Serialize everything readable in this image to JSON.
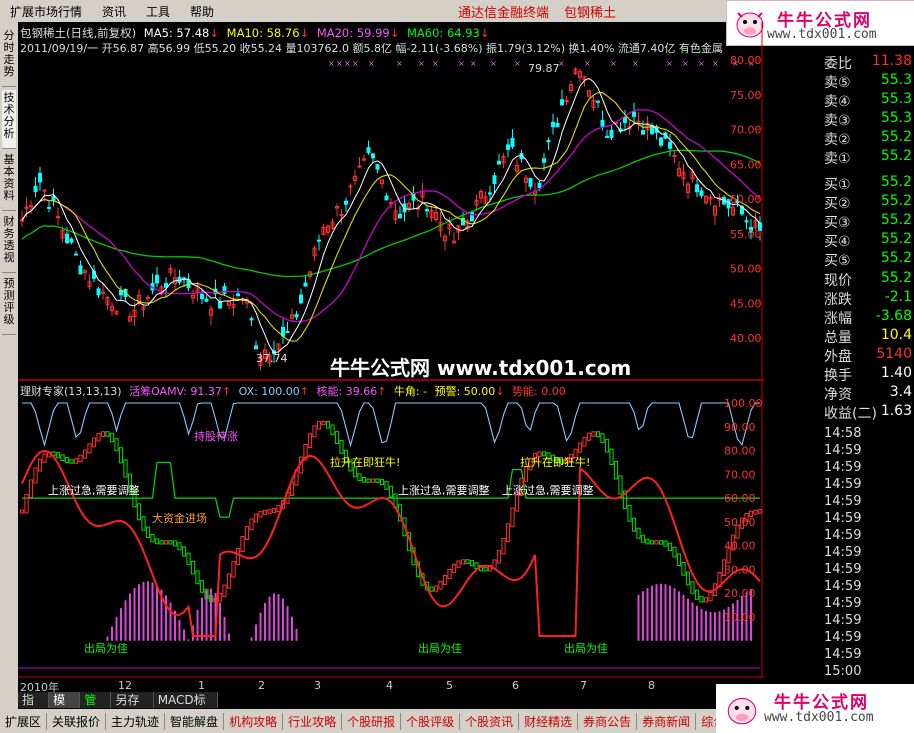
{
  "menu": {
    "items": [
      "扩展市场行情",
      "资讯",
      "工具",
      "帮助"
    ],
    "title": "通达信金融终端",
    "subtitle": "包钢稀土"
  },
  "logo": {
    "text": "牛牛公式网",
    "url": "www.tdx001.com"
  },
  "left_tabs": [
    "分时走势",
    "技术分析",
    "基本资料",
    "财务透视",
    "预测评级"
  ],
  "price_header": {
    "line1": {
      "name": "包钢稀土(日线,前复权)",
      "ma5": "MA5: 57.48",
      "ma10": "MA10: 58.76",
      "ma20": "MA20: 59.99",
      "ma60": "MA60: 64.93"
    },
    "line2": "2011/09/19/一 开56.87 高56.99 低55.20 收55.24 量103762.0 额5.8亿 幅-2.11(-3.68%) 振1.79(3.12%) 换1.40% 流通7.40亿 有色金属"
  },
  "price_axis": [
    "80.00",
    "75.00",
    "70.00",
    "65.00",
    "60.00",
    "55.00",
    "50.00",
    "45.00",
    "40.00"
  ],
  "price_marks": {
    "high": "79.87",
    "low": "37.74"
  },
  "indicator_header": {
    "name": "理财专家(13,13,13)",
    "a": "活筹OAMV: 91.37",
    "b": "OX: 100.00",
    "c": "核能: 39.66",
    "d": "牛角: -",
    "e": "预警: 50.00",
    "f": "势能: 0.00"
  },
  "indicator_axis": [
    "100.00",
    "90.00",
    "80.00",
    "70.00",
    "60.00",
    "50.00",
    "40.00",
    "30.00",
    "20.00",
    "10.00"
  ],
  "annotations": {
    "hold": "持股待涨",
    "rally1": "拉升在即狂牛!",
    "rally2": "拉升在即狂牛!",
    "adj1": "上涨过急,需要调整",
    "adj2": "上涨过急,需要调整",
    "adj3": "上涨过急,需要调整",
    "bigfund": "大资金进场",
    "exit1": "出局为佳",
    "exit2": "出局为佳",
    "exit3": "出局为佳"
  },
  "time_axis": [
    "2010年",
    "12",
    "1",
    "2",
    "3",
    "4",
    "5",
    "6",
    "7",
    "8"
  ],
  "watermark": "牛牛公式网 www.tdx001.com",
  "right_panel": {
    "weibi": {
      "label": "委比",
      "value": "11.38"
    },
    "asks": [
      {
        "label": "卖⑤",
        "value": "55.3"
      },
      {
        "label": "卖④",
        "value": "55.3"
      },
      {
        "label": "卖③",
        "value": "55.3"
      },
      {
        "label": "卖②",
        "value": "55.2"
      },
      {
        "label": "卖①",
        "value": "55.2"
      }
    ],
    "bids": [
      {
        "label": "买①",
        "value": "55.2"
      },
      {
        "label": "买②",
        "value": "55.2"
      },
      {
        "label": "买③",
        "value": "55.2"
      },
      {
        "label": "买④",
        "value": "55.2"
      },
      {
        "label": "买⑤",
        "value": "55.2"
      }
    ],
    "stats": [
      {
        "label": "现价",
        "value": "55.2"
      },
      {
        "label": "涨跌",
        "value": "-2.1"
      },
      {
        "label": "涨幅",
        "value": "-3.68"
      },
      {
        "label": "总量",
        "value": "10.4"
      },
      {
        "label": "外盘",
        "value": "5140"
      },
      {
        "label": "换手",
        "value": "1.40"
      },
      {
        "label": "净资",
        "value": "3.4"
      },
      {
        "label": "收益(二)",
        "value": "1.63"
      }
    ],
    "ticks": [
      "14:58",
      "14:59",
      "14:59",
      "14:59",
      "14:59",
      "14:59",
      "14:59",
      "14:59",
      "14:59",
      "14:59",
      "14:59",
      "14:59",
      "14:59",
      "14:59",
      "15:00"
    ]
  },
  "bottom_tabs": [
    "指标",
    "模板",
    "管理",
    "另存为",
    "MACD标准"
  ],
  "status_tabs": [
    "扩展区",
    "关联报价",
    "主力轨迹",
    "智能解盘",
    "机构攻略",
    "行业攻略",
    "个股研报",
    "个股评级",
    "个股资讯",
    "财经精选",
    "券商公告",
    "券商新闻",
    "综合资讯"
  ],
  "colors": {
    "up": "#ff3030",
    "down": "#00ffff",
    "ma5": "#ffffff",
    "ma10": "#ffff00",
    "ma20": "#ff00ff",
    "ma60": "#00ff00"
  }
}
